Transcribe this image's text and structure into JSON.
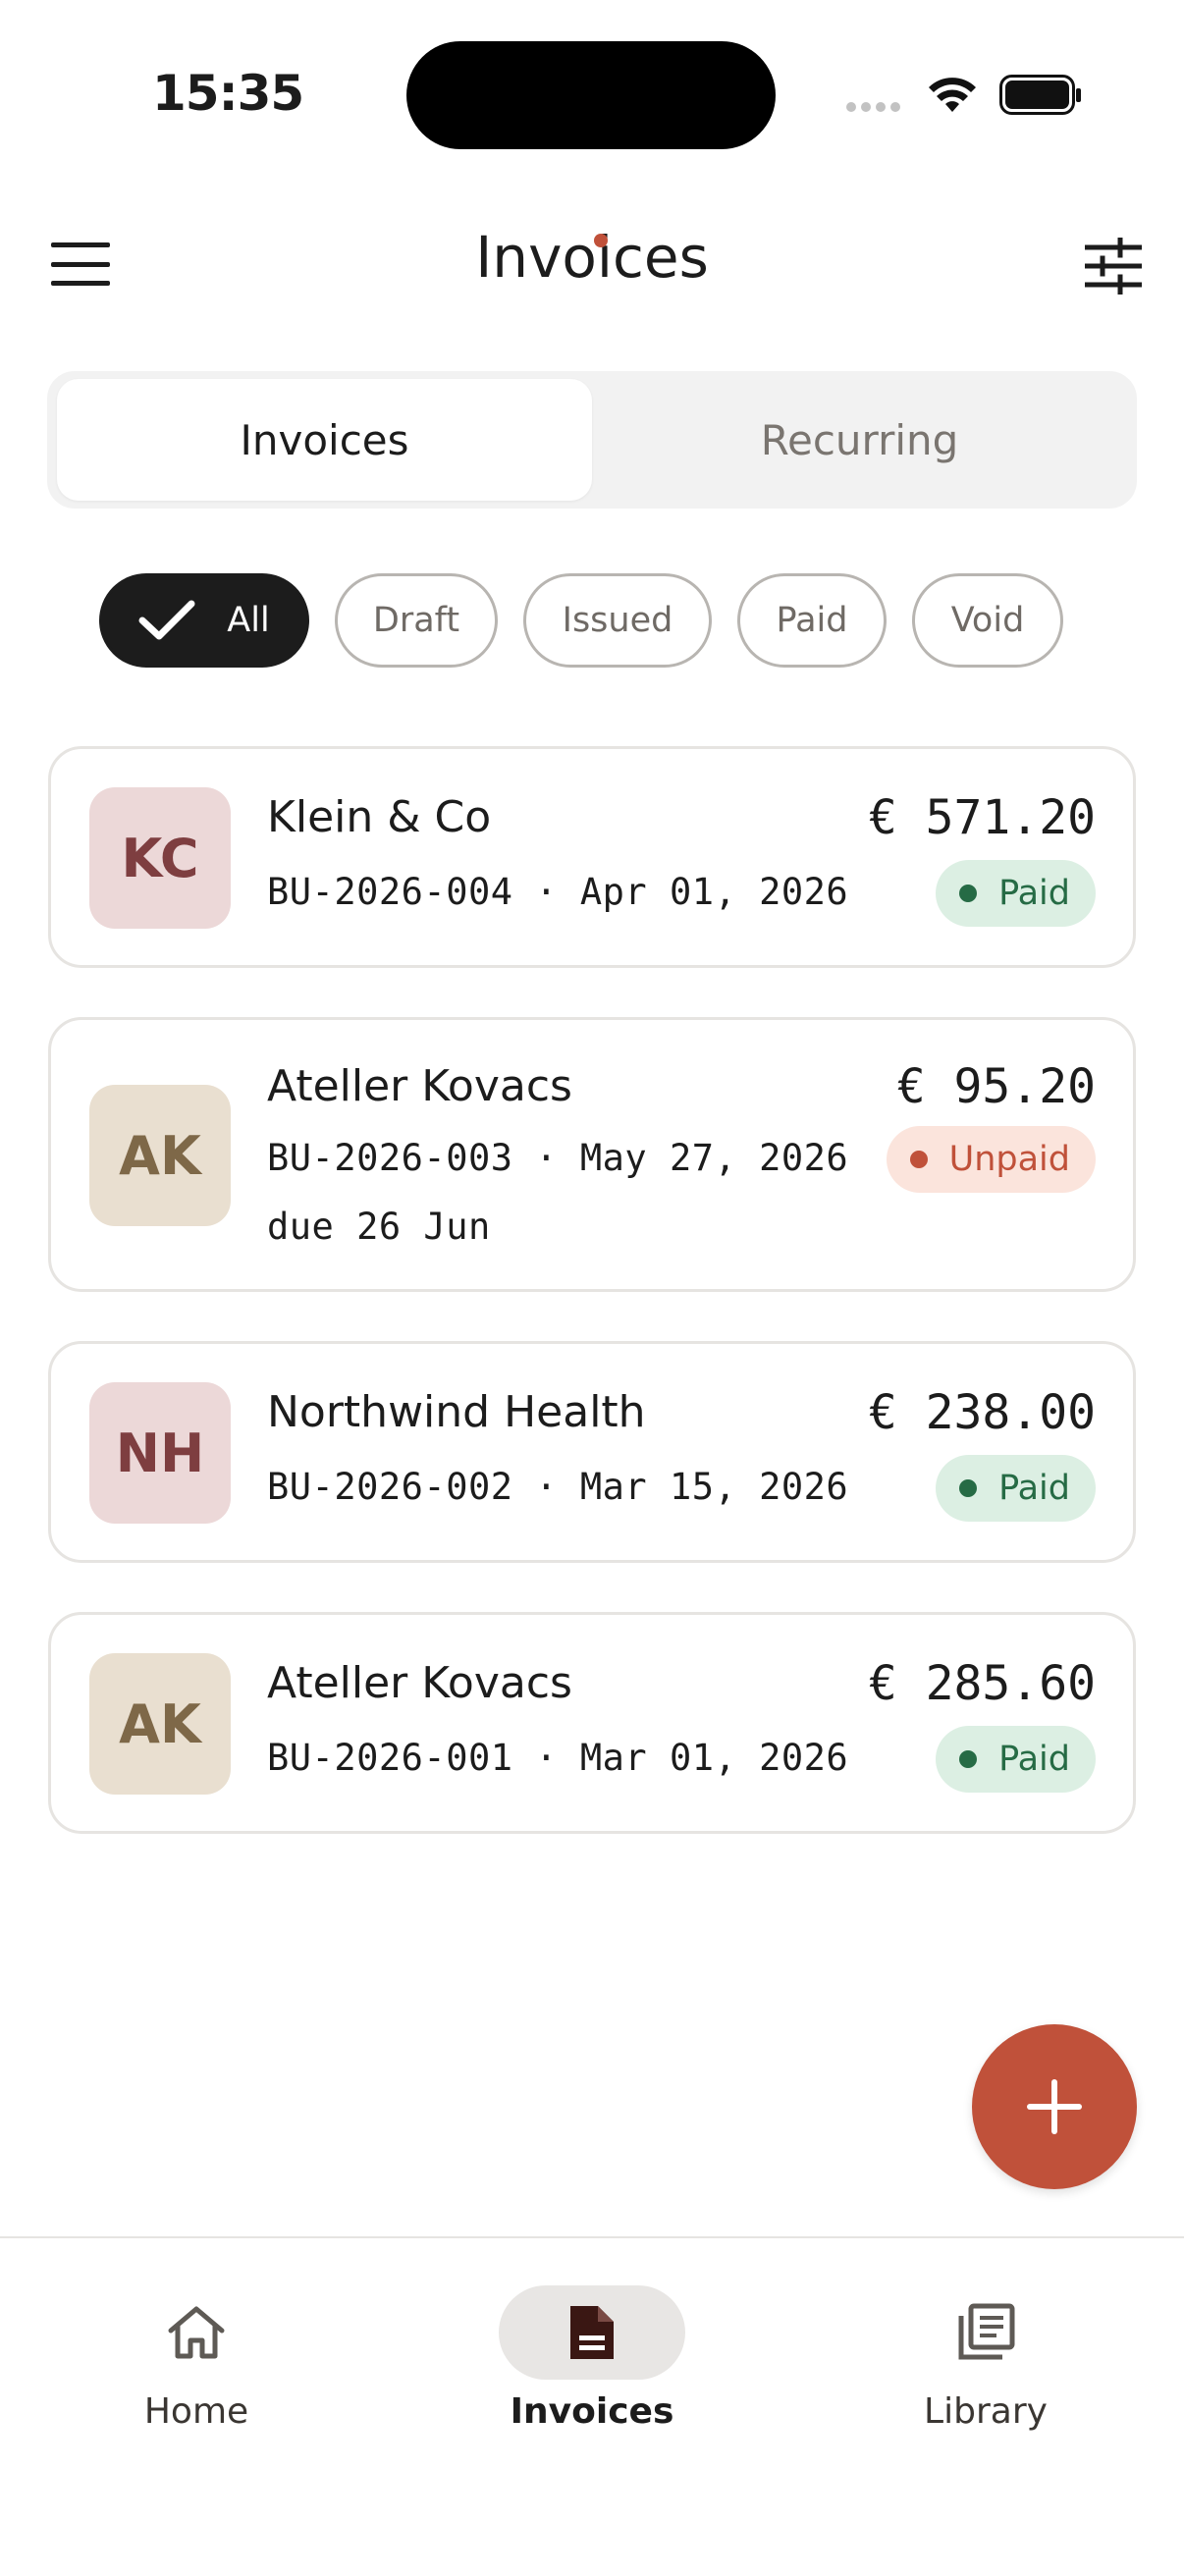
{
  "status_bar": {
    "time": "15:35"
  },
  "header": {
    "title": "Invoices"
  },
  "segments": [
    {
      "label": "Invoices",
      "active": true
    },
    {
      "label": "Recurring",
      "active": false
    }
  ],
  "filters": [
    {
      "label": "All",
      "selected": true
    },
    {
      "label": "Draft",
      "selected": false
    },
    {
      "label": "Issued",
      "selected": false
    },
    {
      "label": "Paid",
      "selected": false
    },
    {
      "label": "Void",
      "selected": false
    }
  ],
  "invoices": [
    {
      "initials": "KC",
      "client": "Klein & Co",
      "meta": "BU-2026-004 · Apr 01, 2026",
      "due": "",
      "amount": "€ 571.20",
      "status": "Paid"
    },
    {
      "initials": "AK",
      "client": "Ateller Kovacs",
      "meta": "BU-2026-003 · May 27, 2026",
      "due": "due 26 Jun",
      "amount": "€ 95.20",
      "status": "Unpaid"
    },
    {
      "initials": "NH",
      "client": "Northwind Health",
      "meta": "BU-2026-002 · Mar 15, 2026",
      "due": "",
      "amount": "€ 238.00",
      "status": "Paid"
    },
    {
      "initials": "AK",
      "client": "Ateller Kovacs",
      "meta": "BU-2026-001 · Mar 01, 2026",
      "due": "",
      "amount": "€ 285.60",
      "status": "Paid"
    }
  ],
  "nav": [
    {
      "label": "Home",
      "icon": "home-icon",
      "active": false
    },
    {
      "label": "Invoices",
      "icon": "document-icon",
      "active": true
    },
    {
      "label": "Library",
      "icon": "library-icon",
      "active": false
    }
  ],
  "colors": {
    "accent": "#c0513a",
    "paid": "#266b45",
    "paid_bg": "#dcefe3",
    "unpaid_bg": "#fbe4dc"
  }
}
